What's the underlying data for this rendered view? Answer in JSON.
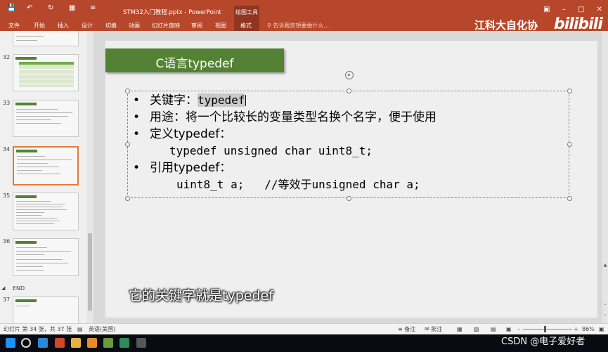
{
  "window": {
    "title": "STM32入门教程.pptx - PowerPoint",
    "contextual_tab_group": "绘图工具"
  },
  "ribbon": {
    "tabs": [
      "文件",
      "开始",
      "插入",
      "设计",
      "切换",
      "动画",
      "幻灯片放映",
      "审阅",
      "视图",
      "格式"
    ],
    "active_tab": "格式",
    "tell_me": "告诉我您想要做什么..."
  },
  "overlay": {
    "brand": "江科大自化协",
    "logo": "bilibili",
    "subtitle": "它的关键字就是typedef",
    "watermark": "CSDN @电子爱好者"
  },
  "thumbnail_pane": {
    "slides": [
      {
        "number": "32",
        "selected": false
      },
      {
        "number": "33",
        "selected": false
      },
      {
        "number": "34",
        "selected": true
      },
      {
        "number": "35",
        "selected": false
      },
      {
        "number": "36",
        "selected": false
      },
      {
        "number": "37",
        "selected": false
      }
    ],
    "section_label": "END"
  },
  "slide": {
    "title": "C语言typedef",
    "bullets": [
      {
        "prefix": "关键字：",
        "code": "typedef"
      },
      {
        "text": "用途：将一个比较长的变量类型名换个名字，便于使用"
      },
      {
        "text": "定义typedef："
      },
      {
        "text": "引用typedef："
      }
    ],
    "code_lines": [
      "typedef unsigned char uint8_t;",
      "uint8_t a;   //等效于unsigned char a;"
    ]
  },
  "statusbar": {
    "slide_info": "幻灯片 第 34 张，共 37 张",
    "language": "英语(美国)",
    "notes": "备注",
    "comments": "批注",
    "zoom": "86%"
  },
  "colors": {
    "ribbon": "#b7472a",
    "title_box": "#548235",
    "selected_thumb": "#e07b39"
  }
}
